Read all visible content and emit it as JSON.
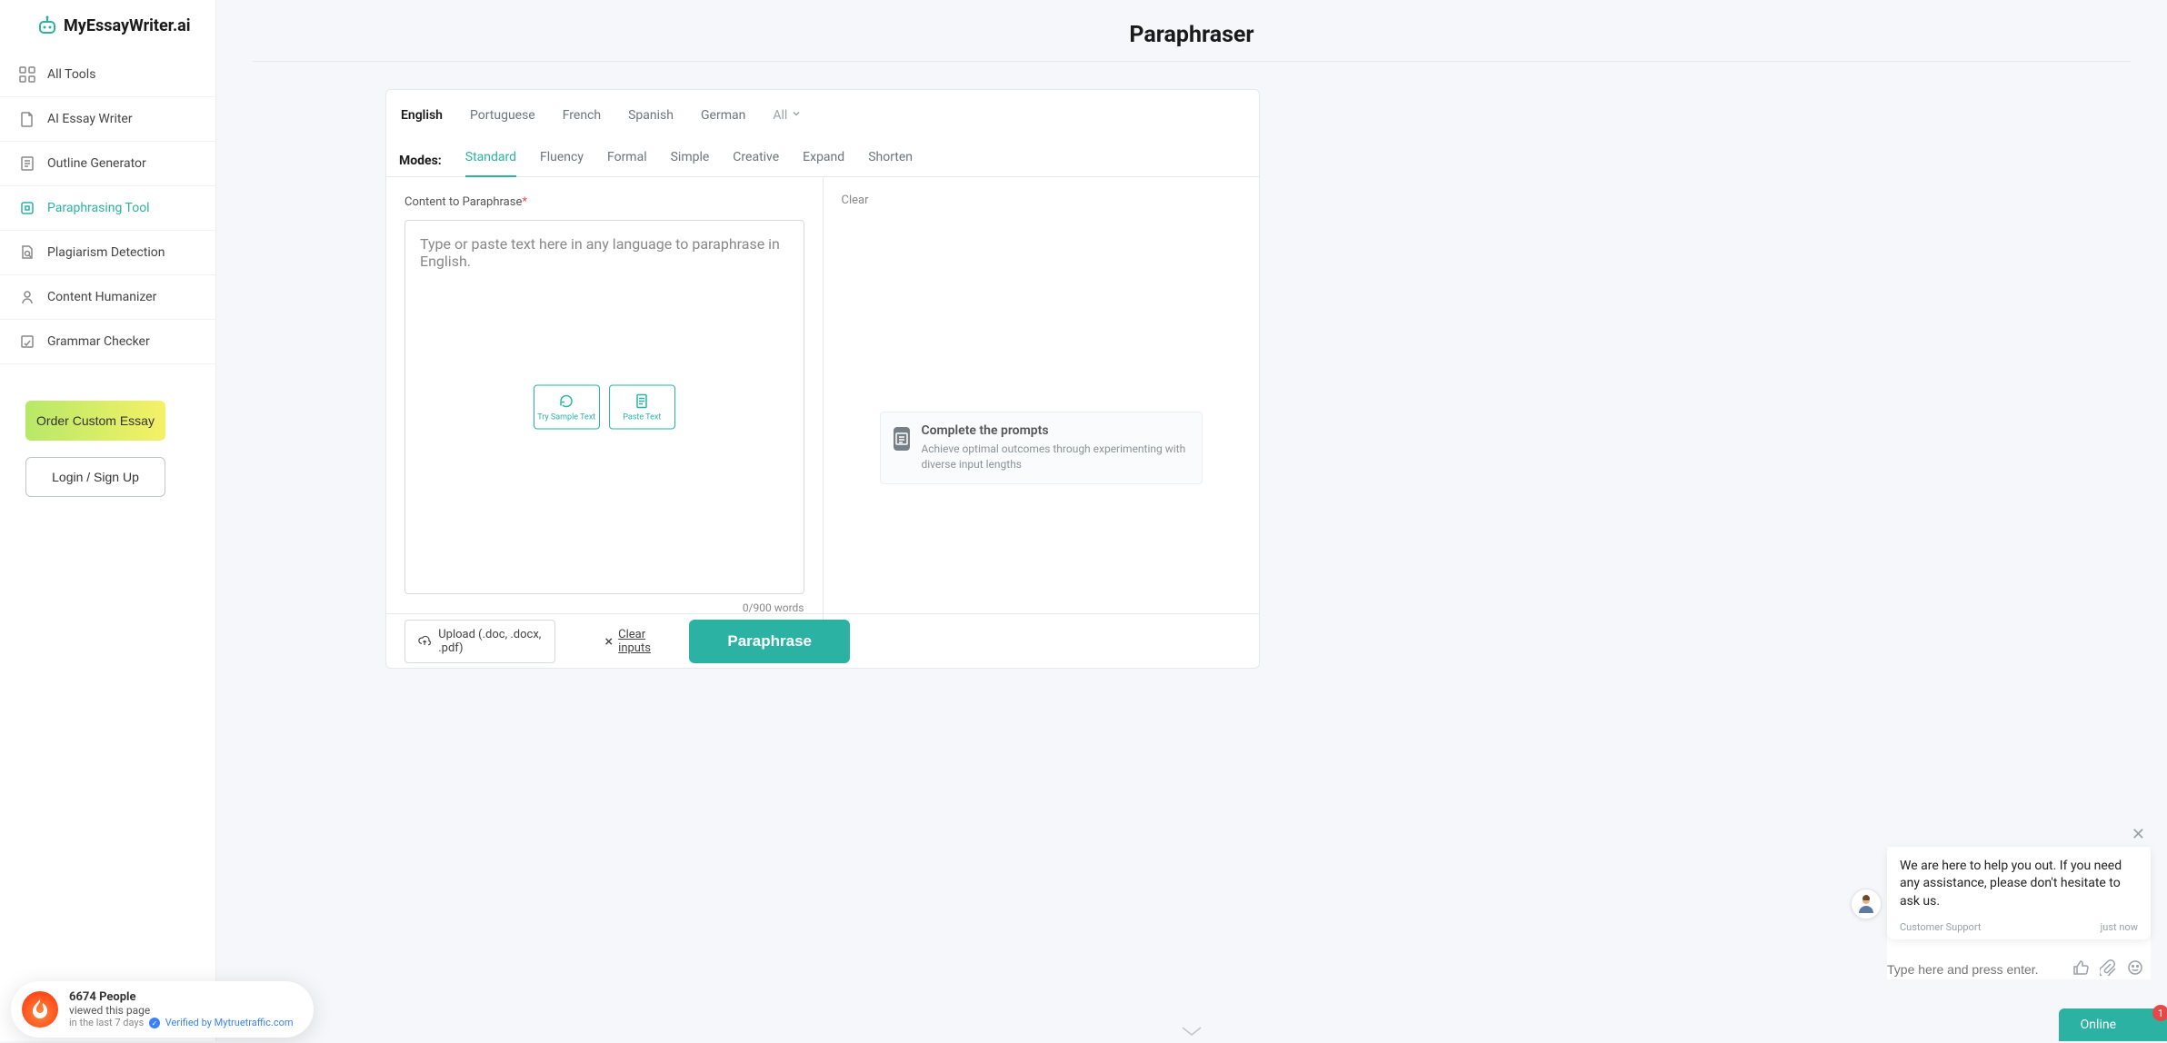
{
  "brand": "MyEssayWriter.ai",
  "page_title": "Paraphraser",
  "sidebar": {
    "items": [
      {
        "label": "All Tools",
        "icon": "grid",
        "active": false
      },
      {
        "label": "AI Essay Writer",
        "icon": "doc",
        "active": false
      },
      {
        "label": "Outline Generator",
        "icon": "outline",
        "active": false
      },
      {
        "label": "Paraphrasing Tool",
        "icon": "refresh",
        "active": true
      },
      {
        "label": "Plagiarism Detection",
        "icon": "search-doc",
        "active": false
      },
      {
        "label": "Content Humanizer",
        "icon": "humanize",
        "active": false
      },
      {
        "label": "Grammar Checker",
        "icon": "grammar",
        "active": false
      }
    ],
    "order_essay": "Order Custom Essay",
    "login": "Login / Sign Up"
  },
  "languages": [
    {
      "label": "English",
      "active": true
    },
    {
      "label": "Portuguese",
      "active": false
    },
    {
      "label": "French",
      "active": false
    },
    {
      "label": "Spanish",
      "active": false
    },
    {
      "label": "German",
      "active": false
    }
  ],
  "lang_all": "All",
  "modes_label": "Modes:",
  "modes": [
    {
      "label": "Standard",
      "active": true
    },
    {
      "label": "Fluency",
      "active": false
    },
    {
      "label": "Formal",
      "active": false
    },
    {
      "label": "Simple",
      "active": false
    },
    {
      "label": "Creative",
      "active": false
    },
    {
      "label": "Expand",
      "active": false
    },
    {
      "label": "Shorten",
      "active": false
    }
  ],
  "input": {
    "label": "Content to Paraphrase",
    "required_mark": "*",
    "placeholder": "Type or paste text here in any language to paraphrase in English.",
    "word_count": "0/900 words",
    "try_sample": "Try Sample Text",
    "paste_text": "Paste Text"
  },
  "output": {
    "clear": "Clear",
    "tip_title": "Complete the prompts",
    "tip_desc": "Achieve optimal outcomes through experimenting with diverse input lengths"
  },
  "bottom": {
    "upload": "Upload (.doc, .docx, .pdf)",
    "clear_inputs": "Clear inputs",
    "paraphrase": "Paraphrase"
  },
  "traffic": {
    "count": "6674 People",
    "line2": "viewed this page",
    "line3": "in the last 7 days",
    "verified": "Verified by Mytruetraffic.com"
  },
  "chat": {
    "message": "We are here to help you out. If you need any assistance, please don't hesitate to ask us.",
    "from": "Customer Support",
    "time": "just now",
    "input_placeholder": "Type here and press enter.",
    "status": "Online",
    "notif": "1"
  }
}
